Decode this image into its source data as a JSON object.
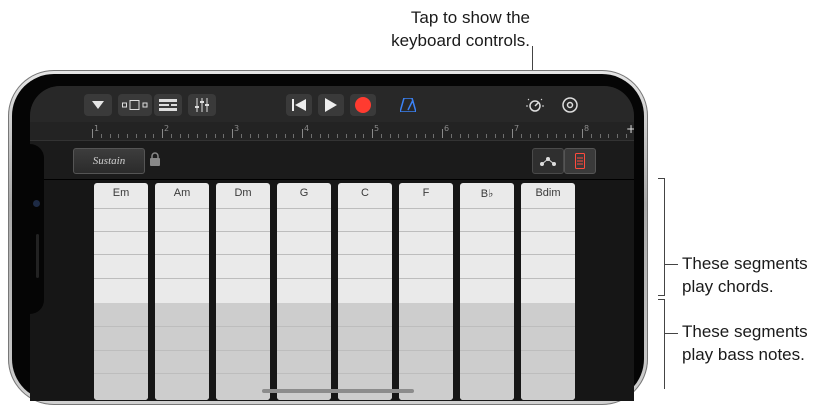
{
  "callouts": {
    "top_line1": "Tap to show the",
    "top_line2": "keyboard controls.",
    "chords_line1": "These segments",
    "chords_line2": "play chords.",
    "bass_line1": "These segments",
    "bass_line2": "play bass notes."
  },
  "toolbar": {
    "icons": [
      "chevron-down-icon",
      "view-toggle-icon",
      "tracks-icon",
      "mixer-icon",
      "go-to-start-icon",
      "play-icon",
      "record-icon",
      "metronome-icon",
      "keyboard-controls-icon",
      "settings-icon"
    ],
    "accent_record": "#ff3b30",
    "accent_metronome": "#3b82f6"
  },
  "ruler": {
    "bars": [
      "1",
      "2",
      "3",
      "4",
      "5",
      "6",
      "7",
      "8"
    ],
    "add_label": "+"
  },
  "controls": {
    "sustain_label": "Sustain",
    "icons": [
      "lock-icon",
      "arpeggiator-icon",
      "keyboard-toggle-icon"
    ]
  },
  "chord_strips": [
    {
      "label": "Em"
    },
    {
      "label": "Am"
    },
    {
      "label": "Dm"
    },
    {
      "label": "G"
    },
    {
      "label": "C"
    },
    {
      "label": "F"
    },
    {
      "label": "B♭"
    },
    {
      "label": "Bdim"
    }
  ]
}
